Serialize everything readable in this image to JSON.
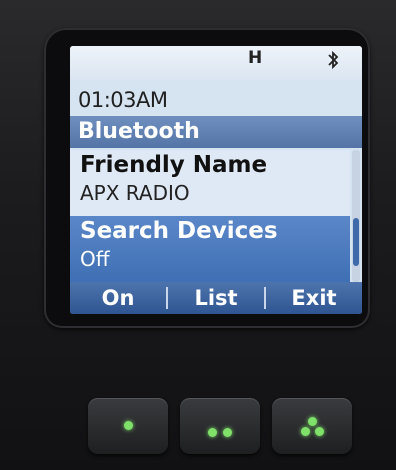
{
  "status": {
    "signal_label": "H",
    "bluetooth_icon": "bluetooth-icon"
  },
  "clock": "01:03AM",
  "menu_title": "Bluetooth",
  "items": [
    {
      "label": "Friendly Name",
      "value": "APX RADIO",
      "selected": false
    },
    {
      "label": "Search Devices",
      "value": "Off",
      "selected": true
    }
  ],
  "softkeys": [
    "On",
    "List",
    "Exit"
  ],
  "hardware_buttons": [
    "one-dot-button",
    "two-dot-button",
    "three-dot-button"
  ],
  "colors": {
    "accent": "#4f77b3",
    "screen_bg": "#d6e3f1",
    "led_green": "#7fe06a"
  }
}
